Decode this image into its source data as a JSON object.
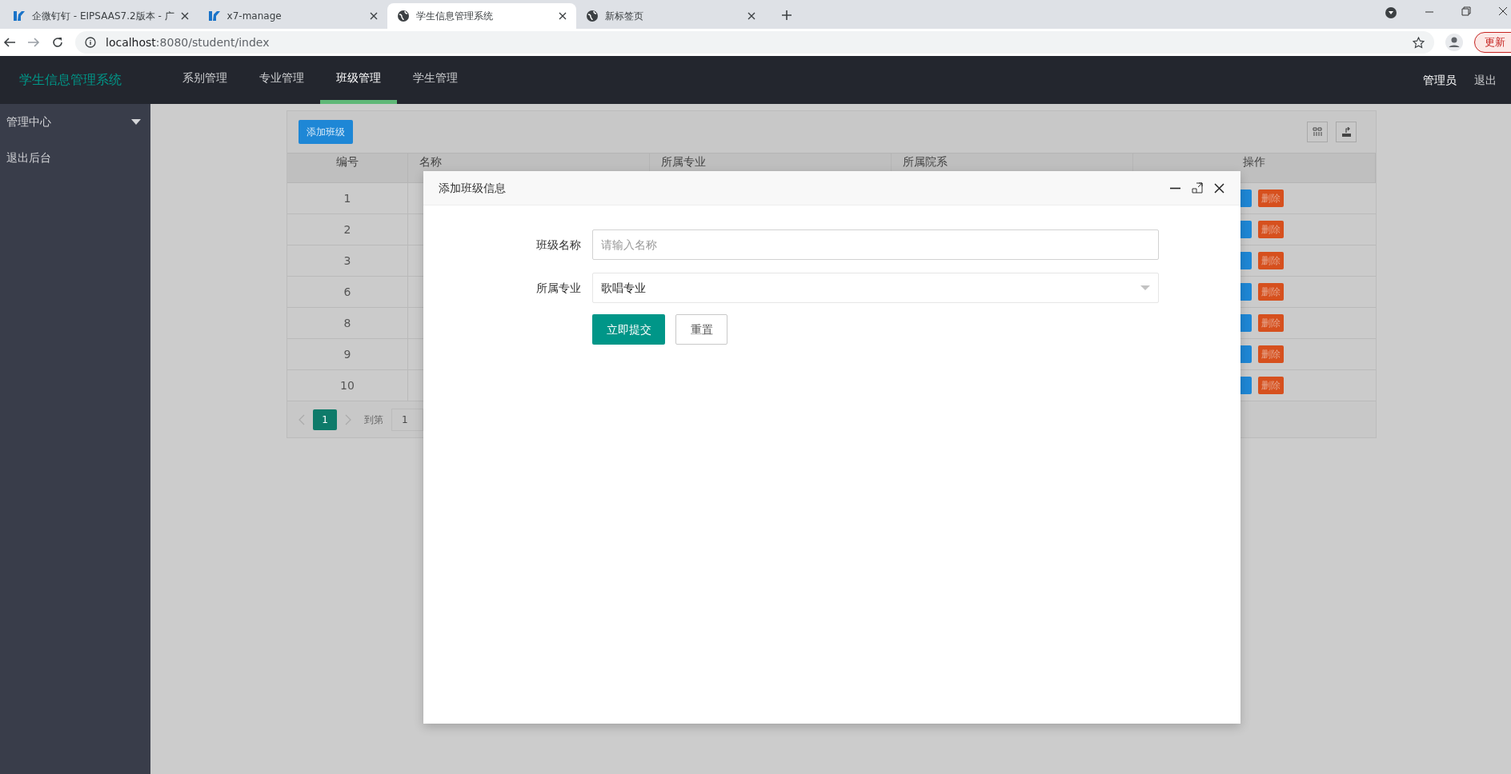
{
  "browser": {
    "tabs": [
      {
        "title": "企微钉钉 - EIPSAAS7.2版本 - 广",
        "kind": "app",
        "selected": false
      },
      {
        "title": "x7-manage",
        "kind": "app",
        "selected": false
      },
      {
        "title": "学生信息管理系统",
        "kind": "web",
        "selected": true
      },
      {
        "title": "新标签页",
        "kind": "web",
        "selected": false
      }
    ],
    "url_host": "localhost",
    "url_rest": ":8080/student/index",
    "update_button": "更新"
  },
  "header": {
    "logo": "学生信息管理系统",
    "nav": [
      {
        "label": "系别管理",
        "selected": false
      },
      {
        "label": "专业管理",
        "selected": false
      },
      {
        "label": "班级管理",
        "selected": true
      },
      {
        "label": "学生管理",
        "selected": false
      }
    ],
    "user": "管理员",
    "logout": "退出"
  },
  "sidebar": {
    "items": [
      {
        "label": "管理中心",
        "kind": "group"
      },
      {
        "label": "退出后台",
        "kind": "link"
      }
    ]
  },
  "toolbar": {
    "add_button": "添加班级"
  },
  "table": {
    "columns": [
      "编号",
      "名称",
      "所属专业",
      "所属院系",
      "操作"
    ],
    "rows": [
      {
        "id": "1",
        "delete": "删除"
      },
      {
        "id": "2",
        "delete": "删除"
      },
      {
        "id": "3",
        "delete": "删除"
      },
      {
        "id": "6",
        "delete": "删除"
      },
      {
        "id": "8",
        "delete": "删除"
      },
      {
        "id": "9",
        "delete": "删除"
      },
      {
        "id": "10",
        "delete": "删除"
      }
    ]
  },
  "pagination": {
    "pages": [
      {
        "label": "1",
        "selected": true
      }
    ],
    "goto_label": "到第",
    "page_value": "1"
  },
  "modal": {
    "title": "添加班级信息",
    "fields": [
      {
        "label": "班级名称",
        "kind": "text",
        "placeholder": "请输入名称"
      },
      {
        "label": "所属专业",
        "kind": "select",
        "value": "歌唱专业"
      }
    ],
    "buttons": [
      {
        "label": "立即提交",
        "kind": "primary"
      },
      {
        "label": "重置",
        "kind": "plain"
      }
    ]
  }
}
